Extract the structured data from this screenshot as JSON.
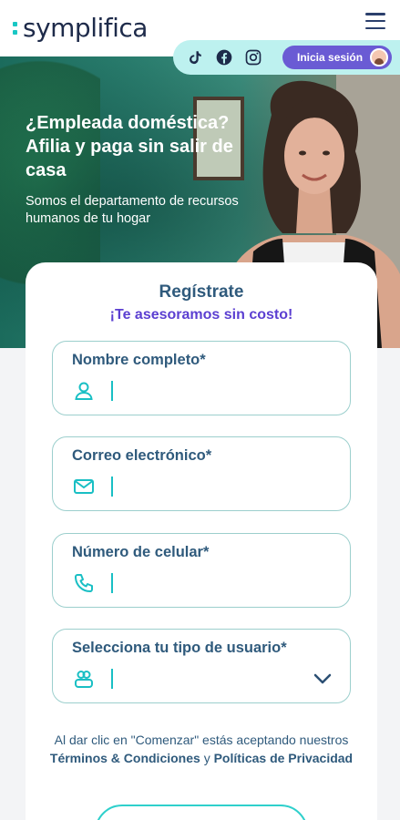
{
  "header": {
    "logo_text": "symplifica",
    "accent_color": "#19c7c4"
  },
  "social": {
    "icons": [
      "tiktok-icon",
      "facebook-icon",
      "instagram-icon"
    ],
    "login_label": "Inicia sesión"
  },
  "hero": {
    "title": "¿Empleada doméstica? Afilia y paga sin salir de casa",
    "subtitle": "Somos el departamento de recursos humanos de tu hogar"
  },
  "form": {
    "title": "Regístrate",
    "subtitle": "¡Te asesoramos sin costo!",
    "fields": [
      {
        "label": "Nombre completo*",
        "icon": "user-icon"
      },
      {
        "label": "Correo electrónico*",
        "icon": "mail-icon"
      },
      {
        "label": "Número de celular*",
        "icon": "phone-icon"
      },
      {
        "label": "Selecciona tu tipo de usuario*",
        "icon": "users-icon"
      }
    ],
    "terms": {
      "prefix": "Al dar clic en \"Comenzar\" estás aceptando nuestros ",
      "terms_link": "Términos & Condiciones",
      "and": " y ",
      "privacy_link": "Políticas de Privacidad"
    }
  }
}
